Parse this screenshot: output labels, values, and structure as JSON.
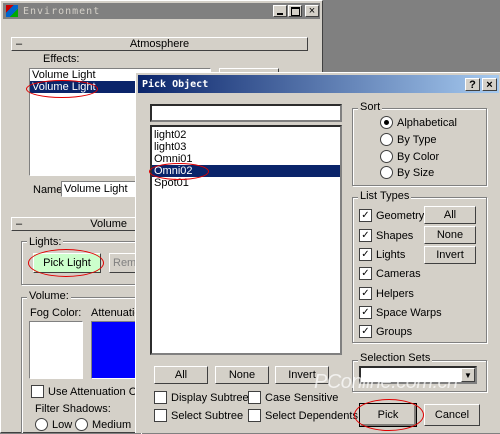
{
  "env": {
    "title": "Environment",
    "atmosphere": "Atmosphere",
    "effects_label": "Effects:",
    "effects": [
      "Volume Light",
      "Volume Light"
    ],
    "name_label": "Name:",
    "name_value": "Volume Light",
    "volume_panel": "Volume",
    "lights_label": "Lights:",
    "pick_light": "Pick Light",
    "remove_label": "Remo",
    "volume_label": "Volume:",
    "fog_color": "Fog Color:",
    "attenuation": "Attenuatio",
    "use_attenuation": "Use Attenuation Colo",
    "filter_shadows": "Filter Shadows:",
    "low": "Low",
    "medium": "Medium",
    "fog_color_value": "#ffffff",
    "attenuation_color_value": "#0000ff"
  },
  "pick": {
    "title": "Pick Object",
    "search_value": "",
    "objects": [
      "light02",
      "light03",
      "Omni01",
      "Omni02",
      "Spot01"
    ],
    "selected_index": 3,
    "sort_label": "Sort",
    "sort_options": [
      "Alphabetical",
      "By Type",
      "By Color",
      "By Size"
    ],
    "sort_selected": 0,
    "list_types_label": "List Types",
    "types": [
      "Geometry",
      "Shapes",
      "Lights",
      "Cameras",
      "Helpers",
      "Space Warps",
      "Groups"
    ],
    "all": "All",
    "none": "None",
    "invert": "Invert",
    "display_subtree": "Display Subtree",
    "case_sensitive": "Case Sensitive",
    "select_subtree": "Select Subtree",
    "select_dependents": "Select Dependents",
    "selection_sets": "Selection Sets",
    "pick_button": "Pick",
    "cancel_button": "Cancel",
    "help": "?",
    "close": "×"
  },
  "watermark": "PConline.com.cn"
}
